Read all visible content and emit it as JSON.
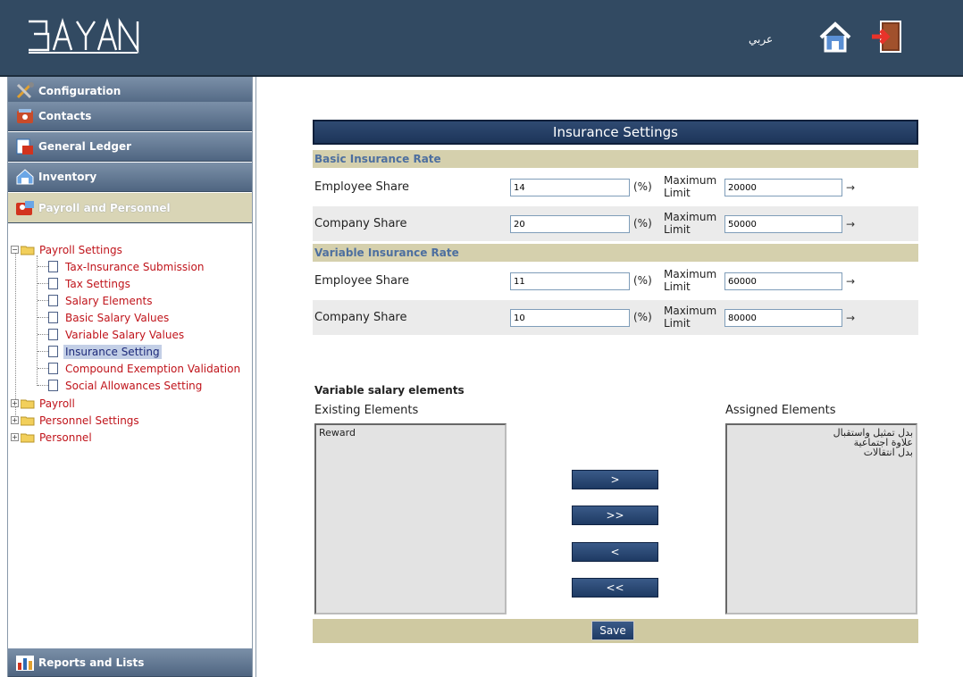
{
  "header": {
    "logo_text": "BAYAN",
    "language_link": "عربي",
    "home_icon": "home-icon",
    "exit_icon": "exit-icon"
  },
  "sidebar": {
    "modules": [
      {
        "label": "Configuration",
        "icon": "tools-icon"
      },
      {
        "label": "Contacts",
        "icon": "contacts-icon"
      },
      {
        "label": "General Ledger",
        "icon": "ledger-icon"
      },
      {
        "label": "Inventory",
        "icon": "inventory-icon"
      },
      {
        "label": "Payroll and Personnel",
        "icon": "personnel-icon"
      }
    ],
    "reports_label": "Reports and Lists",
    "tree": {
      "payroll_settings": "Payroll Settings",
      "children": [
        "Tax-Insurance Submission",
        "Tax Settings",
        "Salary Elements",
        "Basic Salary Values",
        "Variable Salary Values",
        "Insurance Setting",
        "Compound Exemption Validation",
        "Social Allowances Setting"
      ],
      "selected": "Insurance Setting",
      "payroll": "Payroll",
      "personnel_settings": "Personnel Settings",
      "personnel": "Personnel"
    }
  },
  "main": {
    "title": "Insurance Settings",
    "basic_section": "Basic Insurance Rate",
    "variable_section": "Variable Insurance Rate",
    "percent_label": "(%)",
    "max_limit_line1": "Maximum",
    "max_limit_line2": "Limit",
    "arrow": "→",
    "basic_rows": [
      {
        "label": "Employee Share",
        "value": "14",
        "limit": "20000"
      },
      {
        "label": "Company Share",
        "value": "20",
        "limit": "50000"
      }
    ],
    "variable_rows": [
      {
        "label": "Employee Share",
        "value": "11",
        "limit": "60000"
      },
      {
        "label": "Company Share",
        "value": "10",
        "limit": "80000"
      }
    ],
    "variable_salary_elements": "Variable salary elements",
    "existing_label": "Existing Elements",
    "assigned_label": "Assigned Elements",
    "existing_items": [
      "Reward"
    ],
    "assigned_items": [
      "بدل تمثيل واستقبال",
      "علاوة اجتماعية",
      "بدل انتقالات"
    ],
    "move_buttons": [
      ">",
      ">>",
      "<",
      "<<"
    ],
    "save_label": "Save"
  },
  "colors": {
    "header_bg": "#324a62",
    "title_bar": "#1d3559",
    "section_bg": "#d5d0ad",
    "section_text": "#4d6f9f",
    "tree_text": "#c0141b"
  }
}
